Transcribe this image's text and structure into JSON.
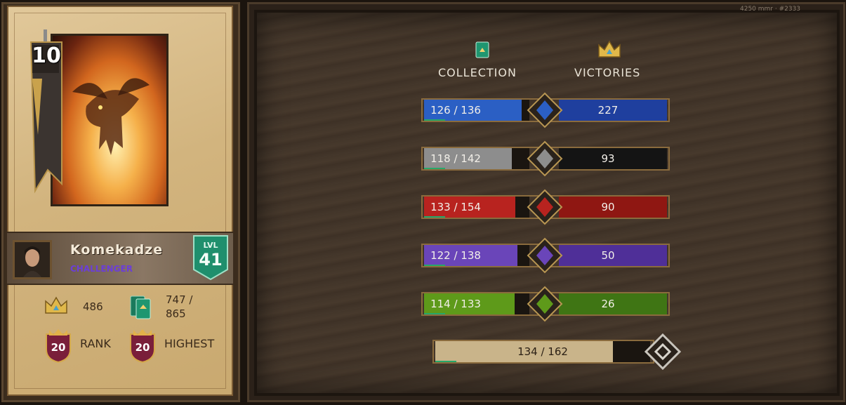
{
  "top_right": {
    "mmr_text": "4250 mmr · #2333"
  },
  "player": {
    "card_power": "10",
    "username": "Komekadze",
    "title": "CHALLENGER",
    "level_label": "LVL",
    "level": "41"
  },
  "stats": {
    "victories": "486",
    "collection_line1": "747 /",
    "collection_line2": "865",
    "rank_value": "20",
    "rank_label": "RANK",
    "highest_value": "20",
    "highest_label": "HIGHEST"
  },
  "headers": {
    "collection": "COLLECTION",
    "victories": "VICTORIES"
  },
  "factions": [
    {
      "name": "northern-realms",
      "collection": "126 / 136",
      "victories": "227",
      "owned": 126,
      "total": 136,
      "color": "#2b5fc4",
      "right_color": "#1f3f9e",
      "icon": "fleur-de-lis-icon"
    },
    {
      "name": "nilfgaard",
      "collection": "118 / 142",
      "victories": "93",
      "owned": 118,
      "total": 142,
      "color": "#8d8d8d",
      "right_color": "#141414",
      "icon": "sun-icon"
    },
    {
      "name": "monsters",
      "collection": "133 / 154",
      "victories": "90",
      "owned": 133,
      "total": 154,
      "color": "#b8231f",
      "right_color": "#8f1712",
      "icon": "claw-icon"
    },
    {
      "name": "skellige",
      "collection": "122 / 138",
      "victories": "50",
      "owned": 122,
      "total": 138,
      "color": "#6a45b9",
      "right_color": "#4f2f98",
      "icon": "anchor-shield-icon"
    },
    {
      "name": "scoiatael",
      "collection": "114 / 133",
      "victories": "26",
      "owned": 114,
      "total": 133,
      "color": "#5e9a1a",
      "right_color": "#3f7514",
      "icon": "arrows-icon"
    }
  ],
  "neutral": {
    "name": "neutral",
    "collection": "134 / 162",
    "owned": 134,
    "total": 162,
    "color": "#c9b48a",
    "icon": "neutral-diamond-icon"
  }
}
